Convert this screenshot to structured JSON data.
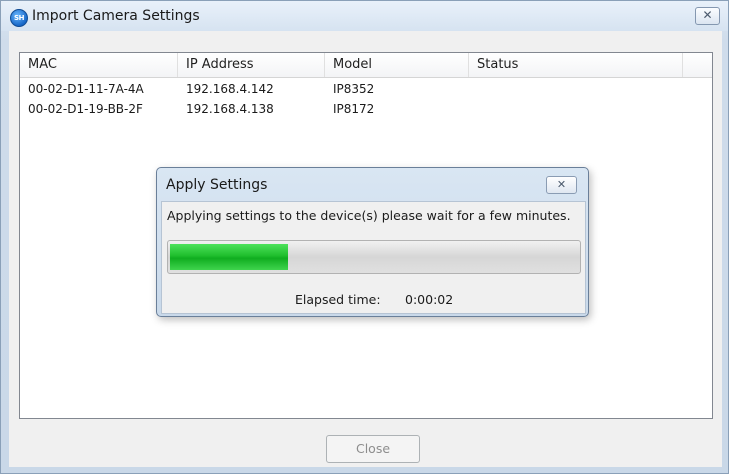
{
  "window": {
    "title": "Import Camera Settings",
    "app_icon_text": "SH",
    "close_glyph": "✕"
  },
  "table": {
    "columns": [
      "MAC",
      "IP Address",
      "Model",
      "Status"
    ],
    "rows": [
      {
        "mac": "00-02-D1-11-7A-4A",
        "ip": "192.168.4.142",
        "model": "IP8352",
        "status": ""
      },
      {
        "mac": "00-02-D1-19-BB-2F",
        "ip": "192.168.4.138",
        "model": "IP8172",
        "status": ""
      }
    ]
  },
  "dialog": {
    "title": "Apply Settings",
    "close_glyph": "✕",
    "message": "Applying settings to the device(s) please wait for a few minutes.",
    "progress": 0.29,
    "elapsed_label": "Elapsed time:",
    "elapsed_value": "0:00:02"
  },
  "footer": {
    "close_label": "Close"
  },
  "colors": {
    "progress_green": "#1fbe2d",
    "disabled_text": "#8d8d8d"
  }
}
